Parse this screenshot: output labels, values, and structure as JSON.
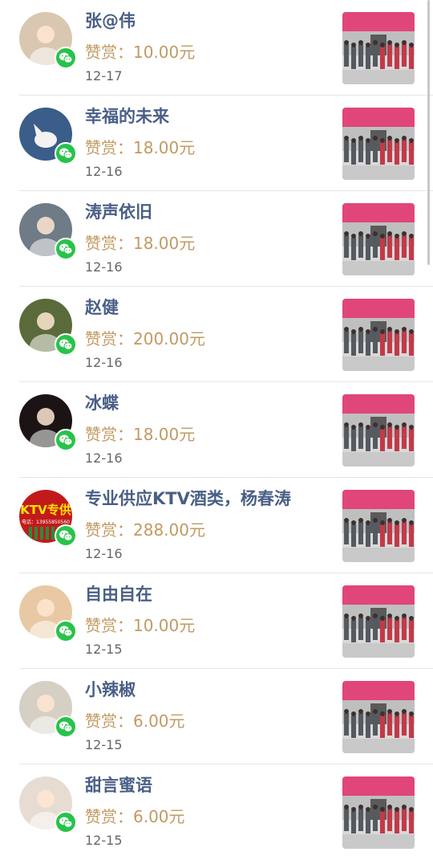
{
  "rows": [
    {
      "name": "张@伟",
      "amount_label": "赞赏：",
      "amount": "10.00元",
      "date": "12-17",
      "avatar_color": "#d9c7b2"
    },
    {
      "name": "幸福的未来",
      "amount_label": "赞赏：",
      "amount": "18.00元",
      "date": "12-16",
      "avatar_color": "#3a5d8a"
    },
    {
      "name": "涛声依旧",
      "amount_label": "赞赏：",
      "amount": "18.00元",
      "date": "12-16",
      "avatar_color": "#6f7b86"
    },
    {
      "name": "赵健",
      "amount_label": "赞赏：",
      "amount": "200.00元",
      "date": "12-16",
      "avatar_color": "#5b6a3a"
    },
    {
      "name": "冰蝶",
      "amount_label": "赞赏：",
      "amount": "18.00元",
      "date": "12-16",
      "avatar_color": "#1c1414"
    },
    {
      "name": "专业供应KTV酒类，杨春涛",
      "amount_label": "赞赏：",
      "amount": "288.00元",
      "date": "12-16",
      "avatar_color": "#c21a1a"
    },
    {
      "name": "自由自在",
      "amount_label": "赞赏：",
      "amount": "10.00元",
      "date": "12-15",
      "avatar_color": "#e8c9a4"
    },
    {
      "name": "小辣椒",
      "amount_label": "赞赏：",
      "amount": "6.00元",
      "date": "12-15",
      "avatar_color": "#d6cfc4"
    },
    {
      "name": "甜言蜜语",
      "amount_label": "赞赏：",
      "amount": "6.00元",
      "date": "12-15",
      "avatar_color": "#e6dcd2"
    }
  ],
  "avatar_texts": {
    "ktv_banner": "KTV专供",
    "ktv_phone": "电话：13955850560"
  },
  "colors": {
    "name": "#4a5f86",
    "amount": "#c19a63",
    "wechat_badge": "#27c34a",
    "banner": "#e0467a"
  },
  "icons": {
    "badge": "wechat-icon",
    "thumb": "article-thumbnail"
  }
}
